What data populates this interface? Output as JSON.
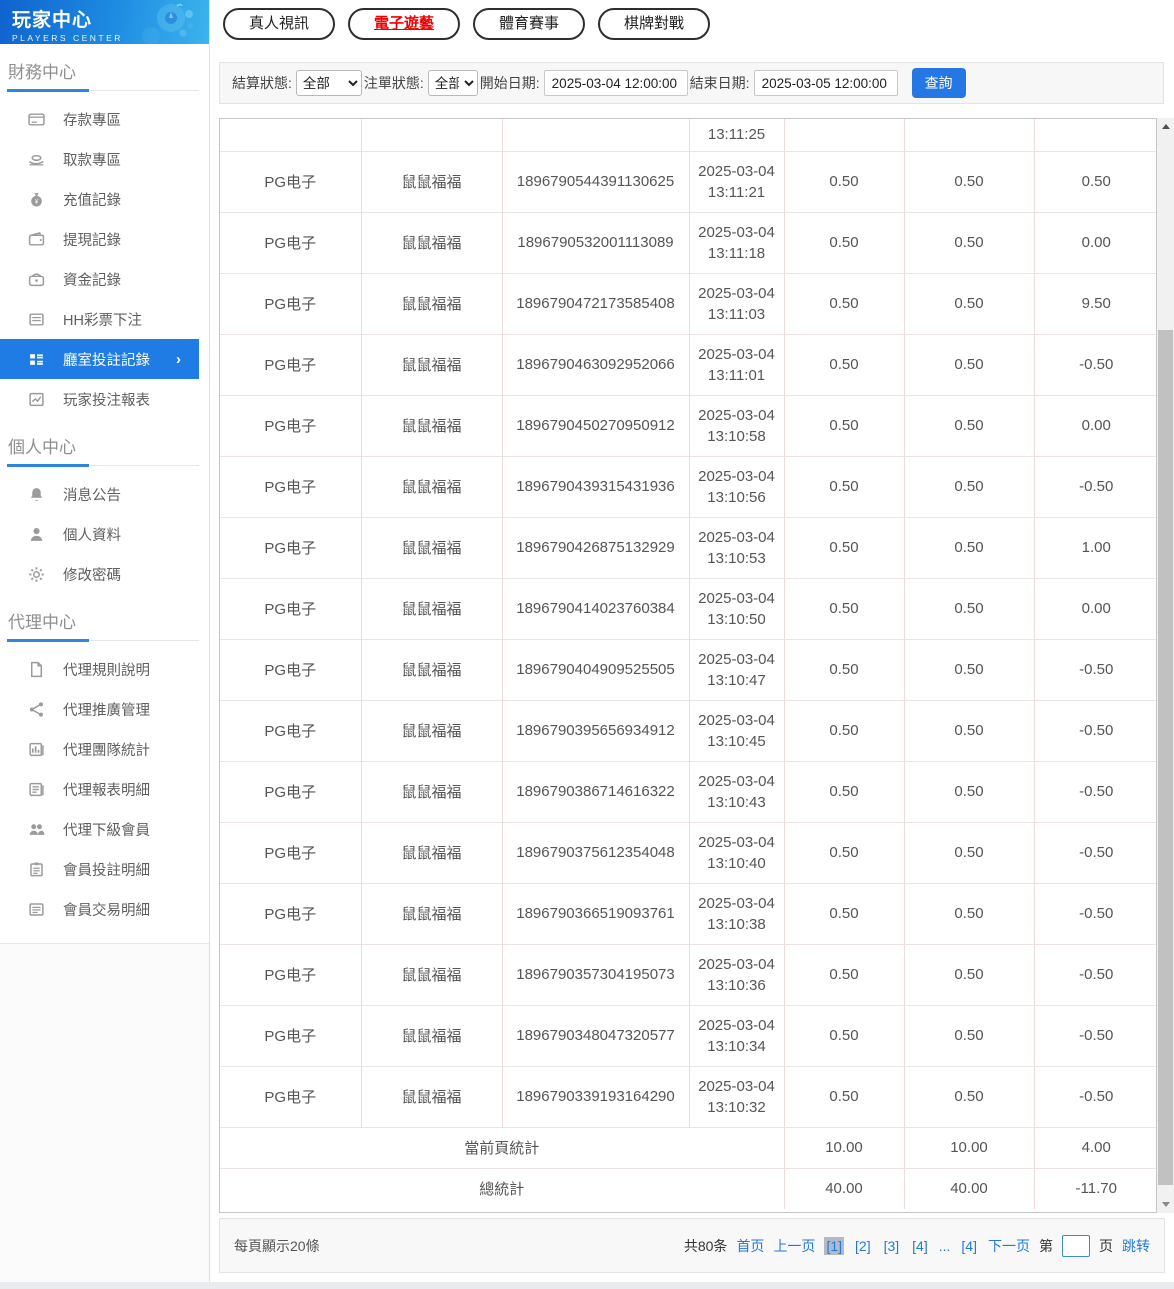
{
  "app": {
    "title": "玩家中心",
    "subtitle": "PLAYERS CENTER"
  },
  "colors": {
    "accent_blue": "#1f7ce4",
    "active_tab_red": "#ee0000",
    "table_border_pink": "#f2d9d9",
    "button_blue": "#2577e3"
  },
  "sidebar": {
    "sections": [
      {
        "heading": "財務中心",
        "items": [
          {
            "label": "存款專區",
            "icon": "deposit-card-icon"
          },
          {
            "label": "取款專區",
            "icon": "withdraw-hand-icon"
          },
          {
            "label": "充值記錄",
            "icon": "money-bag-icon"
          },
          {
            "label": "提現記錄",
            "icon": "wallet-icon"
          },
          {
            "label": "資金記錄",
            "icon": "purse-icon"
          },
          {
            "label": "HH彩票下注",
            "icon": "ledger-icon"
          },
          {
            "label": "廳室投註記錄",
            "icon": "room-list-icon",
            "active": true
          },
          {
            "label": "玩家投注報表",
            "icon": "report-icon"
          }
        ]
      },
      {
        "heading": "個人中心",
        "items": [
          {
            "label": "消息公告",
            "icon": "bell-icon"
          },
          {
            "label": "個人資料",
            "icon": "user-icon"
          },
          {
            "label": "修改密碼",
            "icon": "gear-icon"
          }
        ]
      },
      {
        "heading": "代理中心",
        "items": [
          {
            "label": "代理規則說明",
            "icon": "doc-icon"
          },
          {
            "label": "代理推廣管理",
            "icon": "share-icon"
          },
          {
            "label": "代理團隊統計",
            "icon": "team-stats-icon"
          },
          {
            "label": "代理報表明細",
            "icon": "report-detail-icon"
          },
          {
            "label": "代理下級會員",
            "icon": "members-icon"
          },
          {
            "label": "會員投註明細",
            "icon": "bet-detail-icon"
          },
          {
            "label": "會員交易明細",
            "icon": "transaction-detail-icon"
          }
        ]
      }
    ]
  },
  "tabs": [
    {
      "label": "真人視訊"
    },
    {
      "label": "電子遊藝",
      "active": true
    },
    {
      "label": "體育賽事"
    },
    {
      "label": "棋牌對戰"
    }
  ],
  "filters": {
    "settle_label": "結算狀態:",
    "settle_value": "全部",
    "order_label": "注單狀態:",
    "order_value": "全部",
    "start_label": "開始日期:",
    "start_value": "2025-03-04 12:00:00",
    "end_label": "結束日期:",
    "end_value": "2025-03-05 12:00:00",
    "search_label": "查詢"
  },
  "table": {
    "partial_row_time": "13:11:25",
    "rows": [
      {
        "vendor": "PG电子",
        "game": "鼠鼠福福",
        "order_no": "1896790544391130625",
        "date": "2025-03-04",
        "time": "13:11:21",
        "bet": "0.50",
        "valid": "0.50",
        "payoff": "0.50"
      },
      {
        "vendor": "PG电子",
        "game": "鼠鼠福福",
        "order_no": "1896790532001113089",
        "date": "2025-03-04",
        "time": "13:11:18",
        "bet": "0.50",
        "valid": "0.50",
        "payoff": "0.00"
      },
      {
        "vendor": "PG电子",
        "game": "鼠鼠福福",
        "order_no": "1896790472173585408",
        "date": "2025-03-04",
        "time": "13:11:03",
        "bet": "0.50",
        "valid": "0.50",
        "payoff": "9.50"
      },
      {
        "vendor": "PG电子",
        "game": "鼠鼠福福",
        "order_no": "1896790463092952066",
        "date": "2025-03-04",
        "time": "13:11:01",
        "bet": "0.50",
        "valid": "0.50",
        "payoff": "-0.50"
      },
      {
        "vendor": "PG电子",
        "game": "鼠鼠福福",
        "order_no": "1896790450270950912",
        "date": "2025-03-04",
        "time": "13:10:58",
        "bet": "0.50",
        "valid": "0.50",
        "payoff": "0.00"
      },
      {
        "vendor": "PG电子",
        "game": "鼠鼠福福",
        "order_no": "1896790439315431936",
        "date": "2025-03-04",
        "time": "13:10:56",
        "bet": "0.50",
        "valid": "0.50",
        "payoff": "-0.50"
      },
      {
        "vendor": "PG电子",
        "game": "鼠鼠福福",
        "order_no": "1896790426875132929",
        "date": "2025-03-04",
        "time": "13:10:53",
        "bet": "0.50",
        "valid": "0.50",
        "payoff": "1.00"
      },
      {
        "vendor": "PG电子",
        "game": "鼠鼠福福",
        "order_no": "1896790414023760384",
        "date": "2025-03-04",
        "time": "13:10:50",
        "bet": "0.50",
        "valid": "0.50",
        "payoff": "0.00"
      },
      {
        "vendor": "PG电子",
        "game": "鼠鼠福福",
        "order_no": "1896790404909525505",
        "date": "2025-03-04",
        "time": "13:10:47",
        "bet": "0.50",
        "valid": "0.50",
        "payoff": "-0.50"
      },
      {
        "vendor": "PG电子",
        "game": "鼠鼠福福",
        "order_no": "1896790395656934912",
        "date": "2025-03-04",
        "time": "13:10:45",
        "bet": "0.50",
        "valid": "0.50",
        "payoff": "-0.50"
      },
      {
        "vendor": "PG电子",
        "game": "鼠鼠福福",
        "order_no": "1896790386714616322",
        "date": "2025-03-04",
        "time": "13:10:43",
        "bet": "0.50",
        "valid": "0.50",
        "payoff": "-0.50"
      },
      {
        "vendor": "PG电子",
        "game": "鼠鼠福福",
        "order_no": "1896790375612354048",
        "date": "2025-03-04",
        "time": "13:10:40",
        "bet": "0.50",
        "valid": "0.50",
        "payoff": "-0.50"
      },
      {
        "vendor": "PG电子",
        "game": "鼠鼠福福",
        "order_no": "1896790366519093761",
        "date": "2025-03-04",
        "time": "13:10:38",
        "bet": "0.50",
        "valid": "0.50",
        "payoff": "-0.50"
      },
      {
        "vendor": "PG电子",
        "game": "鼠鼠福福",
        "order_no": "1896790357304195073",
        "date": "2025-03-04",
        "time": "13:10:36",
        "bet": "0.50",
        "valid": "0.50",
        "payoff": "-0.50"
      },
      {
        "vendor": "PG电子",
        "game": "鼠鼠福福",
        "order_no": "1896790348047320577",
        "date": "2025-03-04",
        "time": "13:10:34",
        "bet": "0.50",
        "valid": "0.50",
        "payoff": "-0.50"
      },
      {
        "vendor": "PG电子",
        "game": "鼠鼠福福",
        "order_no": "1896790339193164290",
        "date": "2025-03-04",
        "time": "13:10:32",
        "bet": "0.50",
        "valid": "0.50",
        "payoff": "-0.50"
      }
    ],
    "page_summary": {
      "label": "當前頁統計",
      "bet": "10.00",
      "valid": "10.00",
      "payoff": "4.00"
    },
    "total_summary": {
      "label": "總統計",
      "bet": "40.00",
      "valid": "40.00",
      "payoff": "-11.70"
    }
  },
  "pagination": {
    "page_size_text": "每頁顯示20條",
    "total_text": "共80条",
    "first": "首页",
    "prev": "上一页",
    "pages": [
      {
        "label": "[1]",
        "current": true
      },
      {
        "label": "[2]"
      },
      {
        "label": "[3]"
      },
      {
        "label": "[4]"
      },
      {
        "label": "...",
        "ellipsis": true
      },
      {
        "label": "[4]"
      }
    ],
    "next": "下一页",
    "jump_pre": "第",
    "jump_post": "页",
    "jump_btn": "跳转"
  }
}
